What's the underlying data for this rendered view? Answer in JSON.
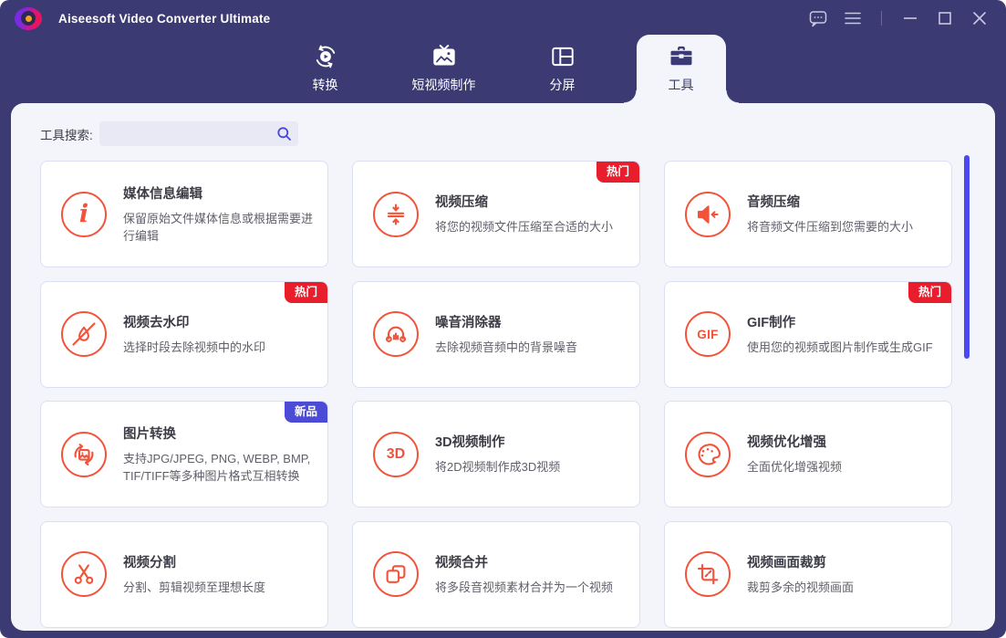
{
  "titlebar": {
    "app_title": "Aiseesoft Video Converter Ultimate",
    "controls_left": [
      {
        "name": "feedback",
        "icon": "feedback-icon"
      },
      {
        "name": "menu",
        "icon": "menu-icon"
      }
    ],
    "controls_right": [
      {
        "name": "minimize",
        "icon": "minimize-icon"
      },
      {
        "name": "maximize",
        "icon": "maximize-icon"
      },
      {
        "name": "close",
        "icon": "close-icon"
      }
    ]
  },
  "nav": {
    "tabs": [
      {
        "id": "convert",
        "label": "转换",
        "icon": "convert-icon",
        "selected": false
      },
      {
        "id": "mv",
        "label": "短视频制作",
        "icon": "mv-icon",
        "selected": false
      },
      {
        "id": "collage",
        "label": "分屏",
        "icon": "collage-icon",
        "selected": false
      },
      {
        "id": "toolbox",
        "label": "工具",
        "icon": "toolbox-icon",
        "selected": true
      }
    ]
  },
  "toolbox": {
    "search_label": "工具搜索:",
    "search_value": "",
    "search_icon": "search-icon",
    "cards": [
      {
        "title": "媒体信息编辑",
        "desc": "保留原始文件媒体信息或根据需要进行编辑",
        "icon": "info-icon",
        "badge": null
      },
      {
        "title": "视频压缩",
        "desc": "将您的视频文件压缩至合适的大小",
        "icon": "compress-icon",
        "badge": {
          "label": "热门",
          "type": "hot"
        }
      },
      {
        "title": "音频压缩",
        "desc": "将音频文件压缩到您需要的大小",
        "icon": "audio-compress-icon",
        "badge": null
      },
      {
        "title": "视频去水印",
        "desc": "选择时段去除视频中的水印",
        "icon": "watermark-remove-icon",
        "badge": {
          "label": "热门",
          "type": "hot"
        }
      },
      {
        "title": "噪音消除器",
        "desc": "去除视频音频中的背景噪音",
        "icon": "headphones-icon",
        "badge": null
      },
      {
        "title": "GIF制作",
        "desc": "使用您的视频或图片制作或生成GIF",
        "icon": "gif-icon",
        "badge": {
          "label": "热门",
          "type": "hot"
        }
      },
      {
        "title": "图片转换",
        "desc": "支持JPG/JPEG, PNG, WEBP, BMP, TIF/TIFF等多种图片格式互相转换",
        "icon": "image-convert-icon",
        "badge": {
          "label": "新品",
          "type": "new"
        }
      },
      {
        "title": "3D视频制作",
        "desc": "将2D视频制作成3D视频",
        "icon": "threed-icon",
        "badge": null
      },
      {
        "title": "视频优化增强",
        "desc": "全面优化增强视频",
        "icon": "palette-icon",
        "badge": null
      },
      {
        "title": "视频分割",
        "desc": "分割、剪辑视频至理想长度",
        "icon": "scissors-icon",
        "badge": null
      },
      {
        "title": "视频合并",
        "desc": "将多段音视频素材合并为一个视频",
        "icon": "merge-icon",
        "badge": null
      },
      {
        "title": "视频画面裁剪",
        "desc": "裁剪多余的视频画面",
        "icon": "crop-icon",
        "badge": null
      }
    ]
  },
  "colors": {
    "frame": "#3b3a73",
    "panel": "#f3f5fb",
    "accent": "#f1543a",
    "hot_badge": "#e91e2c",
    "new_badge": "#4b4bd6",
    "scrollbar": "#4a4af0"
  }
}
